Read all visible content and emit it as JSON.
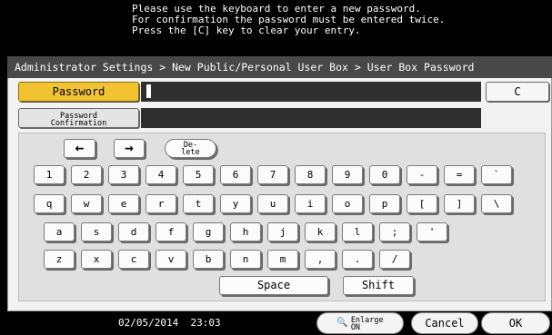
{
  "message": {
    "line1": "Please use the keyboard to enter a new password.",
    "line2": "For confirmation the password must be entered twice.",
    "line3": "Press the [C] key to clear your entry."
  },
  "breadcrumb": "Administrator Settings > New Public/Personal User Box > User Box Password",
  "password": {
    "label": "Password",
    "value": ""
  },
  "confirmation": {
    "label_line1": "Password",
    "label_line2": "Confirmation",
    "value": ""
  },
  "clear_label": "C",
  "keyboard": {
    "left_arrow": "←",
    "right_arrow": "→",
    "delete_line1": "De-",
    "delete_line2": "lete",
    "row1": [
      "1",
      "2",
      "3",
      "4",
      "5",
      "6",
      "7",
      "8",
      "9",
      "0",
      "-",
      "=",
      "`"
    ],
    "row2": [
      "q",
      "w",
      "e",
      "r",
      "t",
      "y",
      "u",
      "i",
      "o",
      "p",
      "[",
      "]",
      "\\"
    ],
    "row3": [
      "a",
      "s",
      "d",
      "f",
      "g",
      "h",
      "j",
      "k",
      "l",
      ";",
      "'"
    ],
    "row4": [
      "z",
      "x",
      "c",
      "v",
      "b",
      "n",
      "m",
      ",",
      ".",
      "/"
    ],
    "space": "Space",
    "shift": "Shift"
  },
  "status": {
    "date": "02/05/2014",
    "time": "23:03"
  },
  "enlarge": {
    "line1": "Enlarge",
    "line2": "ON"
  },
  "cancel_label": "Cancel",
  "ok_label": "OK"
}
